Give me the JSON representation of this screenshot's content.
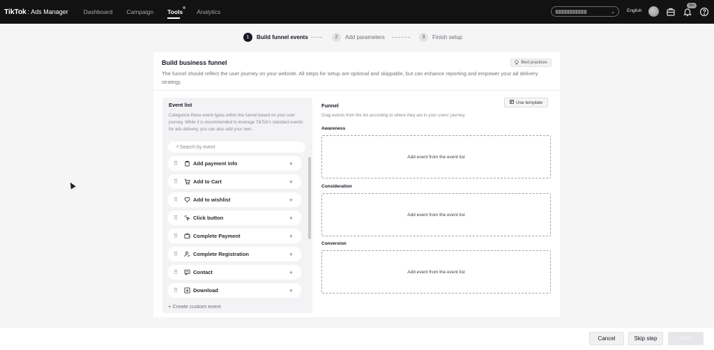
{
  "app": {
    "brand": "TikTok",
    "separator": ":",
    "product": "Ads Manager"
  },
  "nav": {
    "links": [
      "Dashboard",
      "Campaign",
      "Tools",
      "Analytics"
    ],
    "active": "Tools",
    "tools_superscript": "®",
    "language": "English",
    "notification_count": "99+"
  },
  "stepper": {
    "steps": [
      {
        "num": "1",
        "label": "Build funnel events",
        "active": true
      },
      {
        "num": "2",
        "label": "Add parameters",
        "active": false
      },
      {
        "num": "3",
        "label": "Finish setup",
        "active": false
      }
    ]
  },
  "card": {
    "title": "Build business funnel",
    "description": "The funnel should reflect the user journey on your website. All steps for setup are optional and skippable, but can enhance reporting and empower your ad delivery strategy.",
    "best_practices": "Best practices"
  },
  "event_list": {
    "title": "Event list",
    "description": "Categorize these event types within the funnel based on your user journey. While it is recommended to leverage TikTok's standard events for ads delivery, you can also add your own.",
    "search_placeholder": "Search by event",
    "events": [
      {
        "label": "Add payment info",
        "icon": "clipboard-icon"
      },
      {
        "label": "Add to Cart",
        "icon": "cart-icon"
      },
      {
        "label": "Add to wishlist",
        "icon": "heart-icon"
      },
      {
        "label": "Click button",
        "icon": "click-icon"
      },
      {
        "label": "Complete Payment",
        "icon": "wallet-icon"
      },
      {
        "label": "Complete Registration",
        "icon": "user-check-icon"
      },
      {
        "label": "Contact",
        "icon": "message-icon"
      },
      {
        "label": "Download",
        "icon": "download-icon"
      }
    ],
    "create_custom": "+ Create custom event"
  },
  "funnel": {
    "title": "Funnel",
    "description": "Drag events from the list according to where they are in your users' journey.",
    "use_template": "Use template",
    "stages": [
      {
        "label": "Awareness",
        "placeholder": "Add event from the event list"
      },
      {
        "label": "Consideration",
        "placeholder": "Add event from the event list"
      },
      {
        "label": "Conversion",
        "placeholder": "Add event from the event list"
      }
    ]
  },
  "footer": {
    "cancel": "Cancel",
    "skip": "Skip step",
    "next": "Next"
  }
}
